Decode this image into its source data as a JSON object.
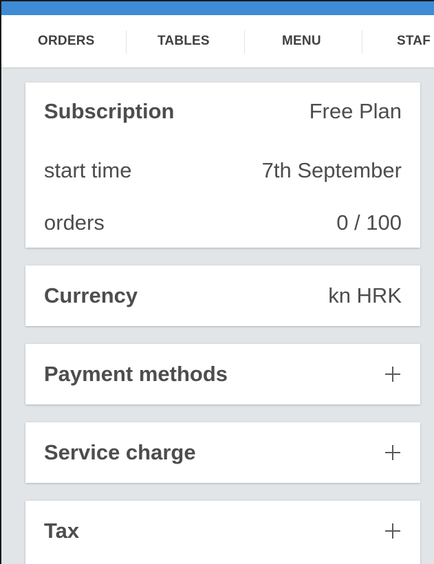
{
  "nav": {
    "tabs": [
      {
        "label": "ORDERS"
      },
      {
        "label": "TABLES"
      },
      {
        "label": "MENU"
      },
      {
        "label": "STAF"
      }
    ]
  },
  "subscription": {
    "title": "Subscription",
    "plan": "Free Plan",
    "start_label": "start time",
    "start_value": "7th September",
    "orders_label": "orders",
    "orders_value": "0 / 100"
  },
  "currency": {
    "title": "Currency",
    "value": "kn HRK"
  },
  "payment_methods": {
    "title": "Payment methods",
    "action_icon": "plus-icon"
  },
  "service_charge": {
    "title": "Service charge",
    "action_icon": "plus-icon"
  },
  "tax": {
    "title": "Tax",
    "action_icon": "plus-icon"
  },
  "colors": {
    "accent": "#3f8bd6",
    "background": "#e1e5e8",
    "card": "#ffffff",
    "text": "#4d4d4d"
  }
}
